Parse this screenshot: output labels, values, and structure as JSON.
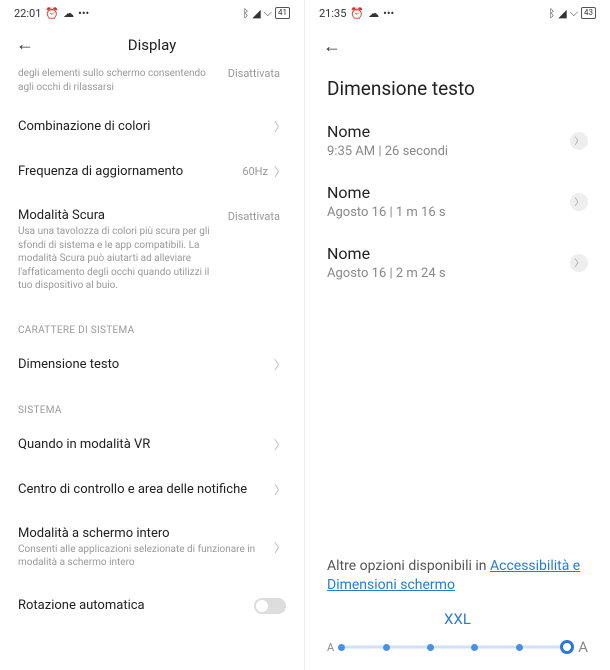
{
  "left": {
    "status_time": "22:01",
    "battery": "41",
    "header": "Display",
    "trunc": "degli elementi sullo schermo consentendo agli occhi di rilassarsi",
    "trunc_val": "Disattivata",
    "rows": {
      "color": "Combinazione di colori",
      "refresh": "Frequenza di aggiornamento",
      "refresh_val": "60Hz",
      "dark_t": "Modalità Scura",
      "dark_d": "Usa una tavolozza di colori più scura per gli sfondi di sistema e le app compatibili. La modalità Scura può aiutarti ad alleviare l'affaticamento degli occhi quando utilizzi il tuo dispositivo al buio.",
      "dark_val": "Disattivata",
      "sect1": "CARATTERE DI SISTEMA",
      "textsize": "Dimensione testo",
      "sect2": "SISTEMA",
      "vr": "Quando in modalità VR",
      "cc": "Centro di controllo e area delle notifiche",
      "fs_t": "Modalità a schermo intero",
      "fs_d": "Consenti alle applicazioni selezionate di funzionare in modalità a schermo intero",
      "rot": "Rotazione automatica"
    }
  },
  "right": {
    "status_time": "21:35",
    "battery": "43",
    "title": "Dimensione testo",
    "items": [
      {
        "name": "Nome",
        "sub": "9:35 AM | 26 secondi"
      },
      {
        "name": "Nome",
        "sub": "Agosto 16 | 1 m 16 s"
      },
      {
        "name": "Nome",
        "sub": "Agosto 16 | 2 m 24 s"
      }
    ],
    "foot_a": "Altre opzioni disponibili in ",
    "foot_link": "Accessibilità e Dimensioni schermo",
    "size_label": "XXL",
    "slider_a": "A"
  }
}
